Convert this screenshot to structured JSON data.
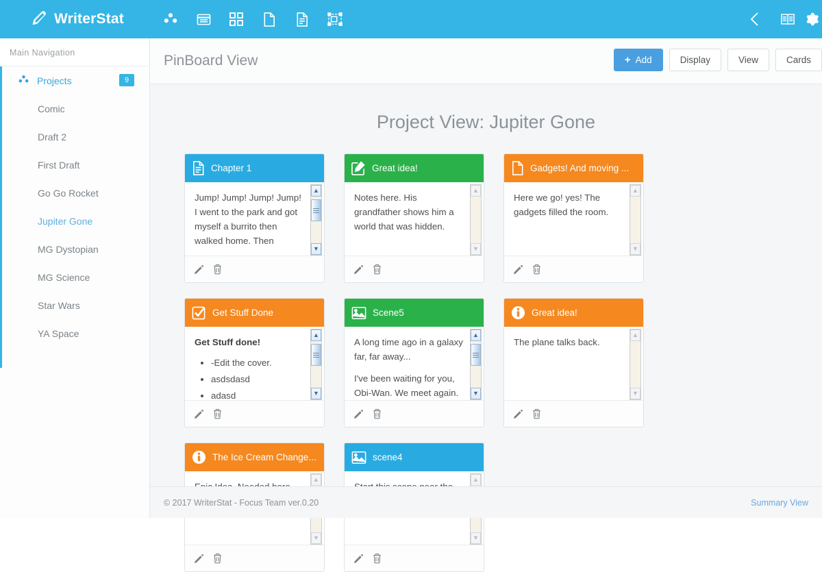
{
  "brand": {
    "name": "WriterStat",
    "logo_icon": "pencil-square-logo-icon"
  },
  "topnav": {
    "icons": [
      {
        "name": "cubes-icon"
      },
      {
        "name": "list-alt-icon"
      },
      {
        "name": "grid-icon"
      },
      {
        "name": "file-blank-icon"
      },
      {
        "name": "file-text-icon"
      },
      {
        "name": "object-group-icon"
      }
    ],
    "right_icons": [
      {
        "name": "chevron-left-icon"
      },
      {
        "name": "book-icon"
      },
      {
        "name": "gear-icon"
      }
    ]
  },
  "sidebar": {
    "heading": "Main Navigation",
    "parent": {
      "label": "Projects",
      "badge": "9",
      "icon": "cubes-icon"
    },
    "items": [
      {
        "label": "Comic",
        "active": false
      },
      {
        "label": "Draft 2",
        "active": false
      },
      {
        "label": "First Draft",
        "active": false
      },
      {
        "label": "Go Go Rocket",
        "active": false
      },
      {
        "label": "Jupiter Gone",
        "active": true
      },
      {
        "label": "MG Dystopian",
        "active": false
      },
      {
        "label": "MG Science",
        "active": false
      },
      {
        "label": "Star Wars",
        "active": false
      },
      {
        "label": "YA Space",
        "active": false
      }
    ]
  },
  "page": {
    "title": "PinBoard View",
    "board_title": "Project View: Jupiter Gone",
    "actions": [
      {
        "label": "Add",
        "style": "primary",
        "icon": "plus-icon"
      },
      {
        "label": "Display",
        "style": "default"
      },
      {
        "label": "View",
        "style": "default"
      },
      {
        "label": "Cards",
        "style": "default"
      }
    ]
  },
  "colors": {
    "brand_blue": "#34b5e5",
    "card_blue": "#29abe2",
    "card_green": "#2bb14a",
    "card_orange": "#f5881f",
    "primary_button": "#4a9fe0",
    "link": "#6aa8dd"
  },
  "cards": [
    {
      "title": "Chapter 1",
      "icon": "file-text-icon",
      "color": "#29abe2",
      "body_text": "Jump! Jump! Jump! Jump! I went to the park and got myself a burrito then walked home. Then",
      "scroll_active": true,
      "edit_label": "edit",
      "delete_label": "delete"
    },
    {
      "title": "Great idea!",
      "icon": "pencil-square-icon",
      "color": "#2bb14a",
      "body_text": "Notes here. His grandfather shows him a world that was hidden.",
      "scroll_active": false,
      "edit_label": "edit",
      "delete_label": "delete"
    },
    {
      "title": "Gadgets! And moving ...",
      "icon": "file-blank-icon",
      "color": "#f5881f",
      "body_text": "Here we go! yes! The gadgets filled the room.",
      "scroll_active": false,
      "edit_label": "edit",
      "delete_label": "delete"
    },
    {
      "title": "Get Stuff Done",
      "icon": "check-square-icon",
      "color": "#f5881f",
      "heading": "Get Stuff done!",
      "bullets": [
        "-Edit the cover.",
        "asdsdasd",
        "adasd"
      ],
      "scroll_active": true,
      "edit_label": "edit",
      "delete_label": "delete"
    },
    {
      "title": "Scene5",
      "icon": "image-icon",
      "color": "#2bb14a",
      "paragraph1": "A long time ago in a galaxy far, far away...",
      "paragraph2": "I've been waiting for you, Obi-Wan. We meet again.",
      "scroll_active": true,
      "edit_label": "edit",
      "delete_label": "delete"
    },
    {
      "title": "Great idea!",
      "icon": "info-circle-icon",
      "color": "#f5881f",
      "body_text": "The plane talks back.",
      "scroll_active": false,
      "edit_label": "edit",
      "delete_label": "delete"
    },
    {
      "title": "The Ice Cream Change...",
      "icon": "info-circle-icon",
      "color": "#f5881f",
      "body_text": "Epic Idea. Needed here.",
      "scroll_active": false,
      "edit_label": "edit",
      "delete_label": "delete"
    },
    {
      "title": "scene4",
      "icon": "image-icon",
      "color": "#29abe2",
      "body_text": "Start this scene near the lake and control center.",
      "scroll_active": false,
      "edit_label": "edit",
      "delete_label": "delete"
    }
  ],
  "footer": {
    "copyright": "© 2017 WriterStat - Focus Team ver.0.20",
    "summary_link": "Summary View"
  }
}
